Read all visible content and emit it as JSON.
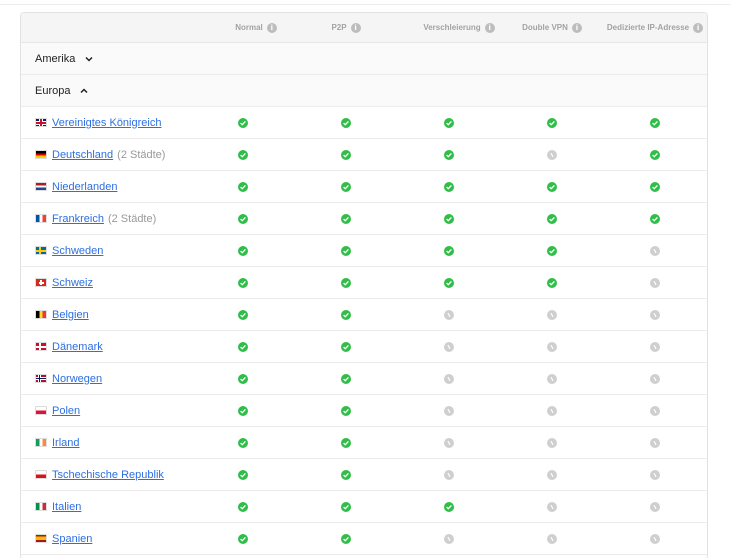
{
  "columns": [
    {
      "label": "Normal"
    },
    {
      "label": "P2P"
    },
    {
      "label": "Verschleierung"
    },
    {
      "label": "Double VPN"
    },
    {
      "label": "Dedizierte IP-Adresse"
    }
  ],
  "regions": {
    "amerika": {
      "label": "Amerika",
      "expanded": false
    },
    "europa": {
      "label": "Europa",
      "expanded": true
    }
  },
  "countries": [
    {
      "name": "Vereinigtes Königreich",
      "cities": "",
      "flag": "uk",
      "support": [
        true,
        true,
        true,
        true,
        true
      ]
    },
    {
      "name": "Deutschland",
      "cities": "(2 Städte)",
      "flag": "de",
      "support": [
        true,
        true,
        true,
        false,
        true
      ]
    },
    {
      "name": "Niederlanden",
      "cities": "",
      "flag": "nl",
      "support": [
        true,
        true,
        true,
        true,
        true
      ]
    },
    {
      "name": "Frankreich",
      "cities": "(2 Städte)",
      "flag": "fr",
      "support": [
        true,
        true,
        true,
        true,
        true
      ]
    },
    {
      "name": "Schweden",
      "cities": "",
      "flag": "se",
      "support": [
        true,
        true,
        true,
        true,
        false
      ]
    },
    {
      "name": "Schweiz",
      "cities": "",
      "flag": "ch",
      "support": [
        true,
        true,
        true,
        true,
        false
      ]
    },
    {
      "name": "Belgien",
      "cities": "",
      "flag": "be",
      "support": [
        true,
        true,
        false,
        false,
        false
      ]
    },
    {
      "name": "Dänemark",
      "cities": "",
      "flag": "dk",
      "support": [
        true,
        true,
        false,
        false,
        false
      ]
    },
    {
      "name": "Norwegen",
      "cities": "",
      "flag": "no",
      "support": [
        true,
        true,
        false,
        false,
        false
      ]
    },
    {
      "name": "Polen",
      "cities": "",
      "flag": "pl",
      "support": [
        true,
        true,
        false,
        false,
        false
      ]
    },
    {
      "name": "Irland",
      "cities": "",
      "flag": "ie",
      "support": [
        true,
        true,
        false,
        false,
        false
      ]
    },
    {
      "name": "Tschechische Republik",
      "cities": "",
      "flag": "cz",
      "support": [
        true,
        true,
        false,
        false,
        false
      ]
    },
    {
      "name": "Italien",
      "cities": "",
      "flag": "it",
      "support": [
        true,
        true,
        true,
        false,
        false
      ]
    },
    {
      "name": "Spanien",
      "cities": "",
      "flag": "es",
      "support": [
        true,
        true,
        false,
        false,
        false
      ]
    }
  ],
  "colors": {
    "supported": "#2fbf49",
    "unsupported": "#cfcfcf",
    "link": "#2d6fe0"
  }
}
